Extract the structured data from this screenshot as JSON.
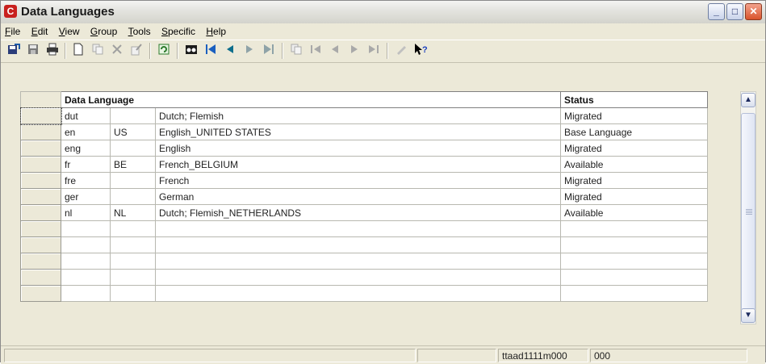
{
  "window": {
    "title": "Data Languages",
    "app_icon_glyph": "C",
    "buttons": {
      "minimize": "_",
      "maximize": "□",
      "close": "✕"
    }
  },
  "menu": [
    {
      "underline": "F",
      "rest": "ile"
    },
    {
      "underline": "E",
      "rest": "dit"
    },
    {
      "underline": "V",
      "rest": "iew"
    },
    {
      "underline": "G",
      "rest": "roup"
    },
    {
      "underline": "T",
      "rest": "ools"
    },
    {
      "underline": "S",
      "rest": "pecific"
    },
    {
      "underline": "H",
      "rest": "elp"
    }
  ],
  "toolbar_icons": [
    "save-and-close-icon",
    "save-icon",
    "print-icon",
    "new-icon",
    "duplicate-icon",
    "delete-icon",
    "change-icon",
    "refresh-icon",
    "find-icon",
    "first-record-icon",
    "previous-record-icon",
    "next-record-icon",
    "last-record-icon",
    "copy-group-icon",
    "first-group-icon",
    "previous-group-icon",
    "next-group-icon",
    "last-group-icon",
    "text-icon",
    "whats-this-icon"
  ],
  "table": {
    "header_data_language": "Data Language",
    "header_status": "Status",
    "rows": [
      {
        "code": "dut",
        "country": "",
        "description": "Dutch; Flemish",
        "status": "Migrated"
      },
      {
        "code": "en",
        "country": "US",
        "description": "English_UNITED STATES",
        "status": "Base Language"
      },
      {
        "code": "eng",
        "country": "",
        "description": "English",
        "status": "Migrated"
      },
      {
        "code": "fr",
        "country": "BE",
        "description": "French_BELGIUM",
        "status": "Available"
      },
      {
        "code": "fre",
        "country": "",
        "description": "French",
        "status": "Migrated"
      },
      {
        "code": "ger",
        "country": "",
        "description": "German",
        "status": "Migrated"
      },
      {
        "code": "nl",
        "country": "NL",
        "description": "Dutch; Flemish_NETHERLANDS",
        "status": "Available"
      },
      {
        "code": "",
        "country": "",
        "description": "",
        "status": ""
      },
      {
        "code": "",
        "country": "",
        "description": "",
        "status": ""
      },
      {
        "code": "",
        "country": "",
        "description": "",
        "status": ""
      },
      {
        "code": "",
        "country": "",
        "description": "",
        "status": ""
      },
      {
        "code": "",
        "country": "",
        "description": "",
        "status": ""
      }
    ]
  },
  "status": {
    "session": "ttaad1111m000",
    "company": "000"
  }
}
